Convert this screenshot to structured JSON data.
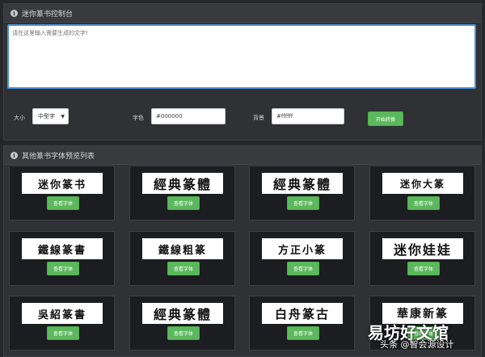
{
  "control_panel": {
    "title": "迷你篆书控制台",
    "textarea_placeholder": "请在这里输入需要生成的文字!",
    "size_label": "大小",
    "size_value": "中型字",
    "color_label": "字色",
    "color_value": "#000000",
    "bg_label": "背景",
    "bg_value": "#ffffff",
    "generate_label": "开始转换"
  },
  "preview_panel": {
    "title": "其他篆书字体预览列表",
    "cards": [
      {
        "sample": "迷你篆书",
        "button": "查看字体"
      },
      {
        "sample": "經典篆體",
        "button": "查看字体"
      },
      {
        "sample": "經典篆體",
        "button": "查看字体"
      },
      {
        "sample": "迷你大篆",
        "button": "查看字体"
      },
      {
        "sample": "鐵線篆書",
        "button": "查看字体"
      },
      {
        "sample": "鐵線粗篆",
        "button": "查看字体"
      },
      {
        "sample": "方正小篆",
        "button": "查看字体"
      },
      {
        "sample": "迷你娃娃",
        "button": "查看字体"
      },
      {
        "sample": "吳紹篆書",
        "button": "查看字体"
      },
      {
        "sample": "經典篆體",
        "button": "查看字体"
      },
      {
        "sample": "白舟篆古",
        "button": "查看字体"
      },
      {
        "sample": "華康新篆",
        "button": "查看字体"
      }
    ]
  },
  "watermark": {
    "text": "易坊好文馆",
    "sub": "头条 @智会源设计"
  }
}
